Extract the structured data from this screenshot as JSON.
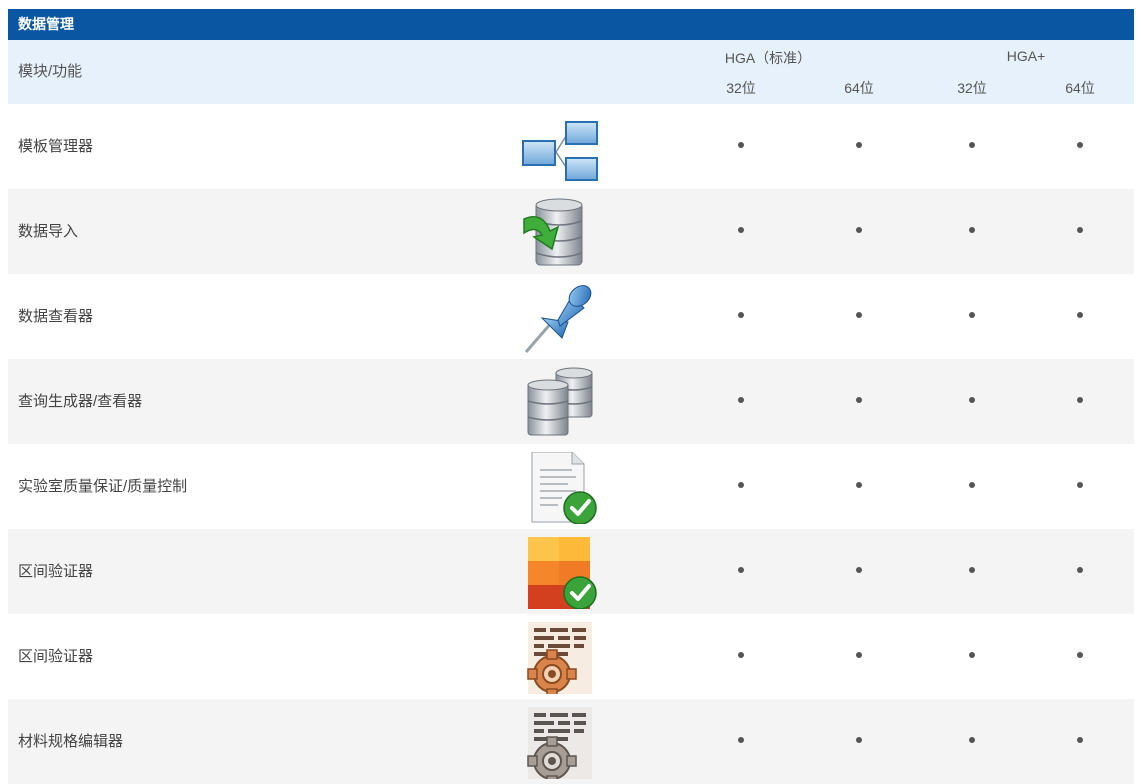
{
  "section_title": "数据管理",
  "header": {
    "module_label": "模块/功能",
    "groups": [
      {
        "label": "HGA（标准）",
        "sub": [
          "32位",
          "64位"
        ]
      },
      {
        "label": "HGA+",
        "sub": [
          "32位",
          "64位"
        ]
      }
    ]
  },
  "rows": [
    {
      "name": "模板管理器",
      "icon": "template-diagram-icon",
      "marks": [
        "•",
        "•",
        "•",
        "•"
      ]
    },
    {
      "name": "数据导入",
      "icon": "database-import-icon",
      "marks": [
        "•",
        "•",
        "•",
        "•"
      ]
    },
    {
      "name": "数据查看器",
      "icon": "pushpin-icon",
      "marks": [
        "•",
        "•",
        "•",
        "•"
      ]
    },
    {
      "name": "查询生成器/查看器",
      "icon": "databases-icon",
      "marks": [
        "•",
        "•",
        "•",
        "•"
      ]
    },
    {
      "name": "实验室质量保证/质量控制",
      "icon": "document-check-icon",
      "marks": [
        "•",
        "•",
        "•",
        "•"
      ]
    },
    {
      "name": "区间验证器",
      "icon": "color-grid-check-icon",
      "marks": [
        "•",
        "•",
        "•",
        "•"
      ]
    },
    {
      "name": "区间验证器",
      "icon": "text-gear-icon",
      "marks": [
        "•",
        "•",
        "•",
        "•"
      ]
    },
    {
      "name": "材料规格编辑器",
      "icon": "text-gear-gray-icon",
      "marks": [
        "•",
        "•",
        "•",
        "•"
      ]
    }
  ]
}
